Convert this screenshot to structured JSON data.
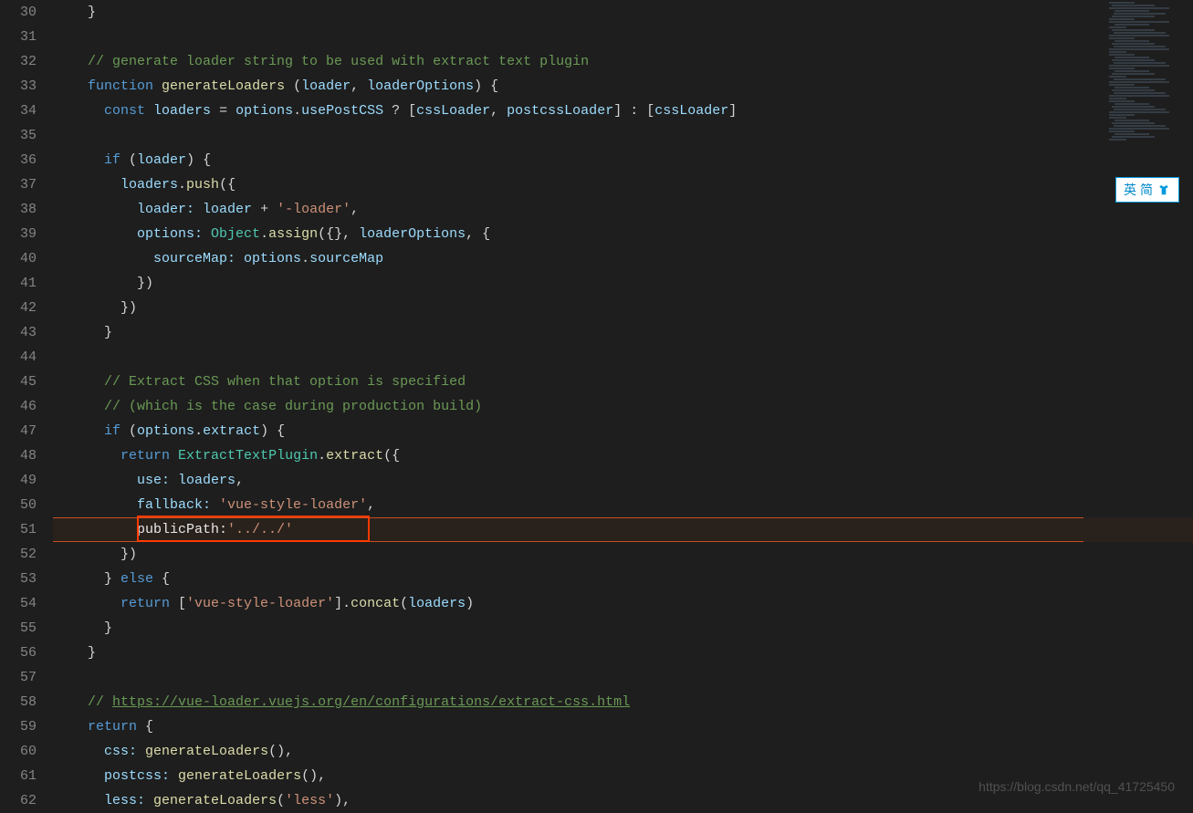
{
  "editor": {
    "startLine": 30,
    "lines": [
      {
        "n": 30,
        "segs": [
          {
            "t": "  }",
            "c": "c-punct"
          }
        ]
      },
      {
        "n": 31,
        "segs": []
      },
      {
        "n": 32,
        "segs": [
          {
            "t": "  ",
            "c": ""
          },
          {
            "t": "// generate loader string to be used with extract text plugin",
            "c": "c-comment"
          }
        ]
      },
      {
        "n": 33,
        "segs": [
          {
            "t": "  ",
            "c": ""
          },
          {
            "t": "function",
            "c": "c-keyword"
          },
          {
            "t": " ",
            "c": ""
          },
          {
            "t": "generateLoaders",
            "c": "c-function"
          },
          {
            "t": " (",
            "c": "c-punct"
          },
          {
            "t": "loader",
            "c": "c-var"
          },
          {
            "t": ", ",
            "c": "c-punct"
          },
          {
            "t": "loaderOptions",
            "c": "c-var"
          },
          {
            "t": ") {",
            "c": "c-punct"
          }
        ]
      },
      {
        "n": 34,
        "segs": [
          {
            "t": "    ",
            "c": ""
          },
          {
            "t": "const",
            "c": "c-keyword"
          },
          {
            "t": " ",
            "c": ""
          },
          {
            "t": "loaders",
            "c": "c-var"
          },
          {
            "t": " = ",
            "c": "c-operator"
          },
          {
            "t": "options",
            "c": "c-var"
          },
          {
            "t": ".",
            "c": "c-punct"
          },
          {
            "t": "usePostCSS",
            "c": "c-var"
          },
          {
            "t": " ? [",
            "c": "c-punct"
          },
          {
            "t": "cssLoader",
            "c": "c-var"
          },
          {
            "t": ", ",
            "c": "c-punct"
          },
          {
            "t": "postcssLoader",
            "c": "c-var"
          },
          {
            "t": "] : [",
            "c": "c-punct"
          },
          {
            "t": "cssLoader",
            "c": "c-var"
          },
          {
            "t": "]",
            "c": "c-punct"
          }
        ]
      },
      {
        "n": 35,
        "segs": []
      },
      {
        "n": 36,
        "segs": [
          {
            "t": "    ",
            "c": ""
          },
          {
            "t": "if",
            "c": "c-keyword"
          },
          {
            "t": " (",
            "c": "c-punct"
          },
          {
            "t": "loader",
            "c": "c-var"
          },
          {
            "t": ") {",
            "c": "c-punct"
          }
        ]
      },
      {
        "n": 37,
        "segs": [
          {
            "t": "      ",
            "c": ""
          },
          {
            "t": "loaders",
            "c": "c-var"
          },
          {
            "t": ".",
            "c": "c-punct"
          },
          {
            "t": "push",
            "c": "c-function"
          },
          {
            "t": "({",
            "c": "c-punct"
          }
        ]
      },
      {
        "n": 38,
        "segs": [
          {
            "t": "        ",
            "c": ""
          },
          {
            "t": "loader:",
            "c": "c-var"
          },
          {
            "t": " ",
            "c": ""
          },
          {
            "t": "loader",
            "c": "c-var"
          },
          {
            "t": " + ",
            "c": "c-operator"
          },
          {
            "t": "'-loader'",
            "c": "c-string"
          },
          {
            "t": ",",
            "c": "c-punct"
          }
        ]
      },
      {
        "n": 39,
        "segs": [
          {
            "t": "        ",
            "c": ""
          },
          {
            "t": "options:",
            "c": "c-var"
          },
          {
            "t": " ",
            "c": ""
          },
          {
            "t": "Object",
            "c": "c-class"
          },
          {
            "t": ".",
            "c": "c-punct"
          },
          {
            "t": "assign",
            "c": "c-function"
          },
          {
            "t": "({}, ",
            "c": "c-punct"
          },
          {
            "t": "loaderOptions",
            "c": "c-var"
          },
          {
            "t": ", {",
            "c": "c-punct"
          }
        ]
      },
      {
        "n": 40,
        "segs": [
          {
            "t": "          ",
            "c": ""
          },
          {
            "t": "sourceMap:",
            "c": "c-var"
          },
          {
            "t": " ",
            "c": ""
          },
          {
            "t": "options",
            "c": "c-var"
          },
          {
            "t": ".",
            "c": "c-punct"
          },
          {
            "t": "sourceMap",
            "c": "c-var"
          }
        ]
      },
      {
        "n": 41,
        "segs": [
          {
            "t": "        })",
            "c": "c-punct"
          }
        ]
      },
      {
        "n": 42,
        "segs": [
          {
            "t": "      })",
            "c": "c-punct"
          }
        ]
      },
      {
        "n": 43,
        "segs": [
          {
            "t": "    }",
            "c": "c-punct"
          }
        ]
      },
      {
        "n": 44,
        "segs": []
      },
      {
        "n": 45,
        "segs": [
          {
            "t": "    ",
            "c": ""
          },
          {
            "t": "// Extract CSS when that option is specified",
            "c": "c-comment"
          }
        ]
      },
      {
        "n": 46,
        "segs": [
          {
            "t": "    ",
            "c": ""
          },
          {
            "t": "// (which is the case during production build)",
            "c": "c-comment"
          }
        ]
      },
      {
        "n": 47,
        "segs": [
          {
            "t": "    ",
            "c": ""
          },
          {
            "t": "if",
            "c": "c-keyword"
          },
          {
            "t": " (",
            "c": "c-punct"
          },
          {
            "t": "options",
            "c": "c-var"
          },
          {
            "t": ".",
            "c": "c-punct"
          },
          {
            "t": "extract",
            "c": "c-var"
          },
          {
            "t": ") {",
            "c": "c-punct"
          }
        ]
      },
      {
        "n": 48,
        "segs": [
          {
            "t": "      ",
            "c": ""
          },
          {
            "t": "return",
            "c": "c-keyword"
          },
          {
            "t": " ",
            "c": ""
          },
          {
            "t": "ExtractTextPlugin",
            "c": "c-class"
          },
          {
            "t": ".",
            "c": "c-punct"
          },
          {
            "t": "extract",
            "c": "c-function"
          },
          {
            "t": "({",
            "c": "c-punct"
          }
        ]
      },
      {
        "n": 49,
        "segs": [
          {
            "t": "        ",
            "c": ""
          },
          {
            "t": "use:",
            "c": "c-var"
          },
          {
            "t": " ",
            "c": ""
          },
          {
            "t": "loaders",
            "c": "c-var"
          },
          {
            "t": ",",
            "c": "c-punct"
          }
        ]
      },
      {
        "n": 50,
        "segs": [
          {
            "t": "        ",
            "c": ""
          },
          {
            "t": "fallback:",
            "c": "c-var"
          },
          {
            "t": " ",
            "c": ""
          },
          {
            "t": "'vue-style-loader'",
            "c": "c-string"
          },
          {
            "t": ",",
            "c": "c-punct"
          }
        ]
      },
      {
        "n": 51,
        "hl": true,
        "segs": [
          {
            "t": "        ",
            "c": ""
          },
          {
            "t": "publicPath:",
            "c": "c-highlight-text"
          },
          {
            "t": "'../../'",
            "c": "c-string"
          }
        ]
      },
      {
        "n": 52,
        "segs": [
          {
            "t": "      })",
            "c": "c-punct"
          }
        ]
      },
      {
        "n": 53,
        "segs": [
          {
            "t": "    } ",
            "c": "c-punct"
          },
          {
            "t": "else",
            "c": "c-keyword"
          },
          {
            "t": " {",
            "c": "c-punct"
          }
        ]
      },
      {
        "n": 54,
        "segs": [
          {
            "t": "      ",
            "c": ""
          },
          {
            "t": "return",
            "c": "c-keyword"
          },
          {
            "t": " [",
            "c": "c-punct"
          },
          {
            "t": "'vue-style-loader'",
            "c": "c-string"
          },
          {
            "t": "].",
            "c": "c-punct"
          },
          {
            "t": "concat",
            "c": "c-function"
          },
          {
            "t": "(",
            "c": "c-punct"
          },
          {
            "t": "loaders",
            "c": "c-var"
          },
          {
            "t": ")",
            "c": "c-punct"
          }
        ]
      },
      {
        "n": 55,
        "segs": [
          {
            "t": "    }",
            "c": "c-punct"
          }
        ]
      },
      {
        "n": 56,
        "segs": [
          {
            "t": "  }",
            "c": "c-punct"
          }
        ]
      },
      {
        "n": 57,
        "segs": []
      },
      {
        "n": 58,
        "segs": [
          {
            "t": "  ",
            "c": ""
          },
          {
            "t": "// ",
            "c": "c-comment"
          },
          {
            "t": "https://vue-loader.vuejs.org/en/configurations/extract-css.html",
            "c": "c-link"
          }
        ]
      },
      {
        "n": 59,
        "segs": [
          {
            "t": "  ",
            "c": ""
          },
          {
            "t": "return",
            "c": "c-keyword"
          },
          {
            "t": " {",
            "c": "c-punct"
          }
        ]
      },
      {
        "n": 60,
        "segs": [
          {
            "t": "    ",
            "c": ""
          },
          {
            "t": "css:",
            "c": "c-var"
          },
          {
            "t": " ",
            "c": ""
          },
          {
            "t": "generateLoaders",
            "c": "c-function"
          },
          {
            "t": "(),",
            "c": "c-punct"
          }
        ]
      },
      {
        "n": 61,
        "segs": [
          {
            "t": "    ",
            "c": ""
          },
          {
            "t": "postcss:",
            "c": "c-var"
          },
          {
            "t": " ",
            "c": ""
          },
          {
            "t": "generateLoaders",
            "c": "c-function"
          },
          {
            "t": "(),",
            "c": "c-punct"
          }
        ]
      },
      {
        "n": 62,
        "segs": [
          {
            "t": "    ",
            "c": ""
          },
          {
            "t": "less:",
            "c": "c-var"
          },
          {
            "t": " ",
            "c": ""
          },
          {
            "t": "generateLoaders",
            "c": "c-function"
          },
          {
            "t": "(",
            "c": "c-punct"
          },
          {
            "t": "'less'",
            "c": "c-string"
          },
          {
            "t": "),",
            "c": "c-punct"
          }
        ]
      }
    ]
  },
  "ime": {
    "text1": "英",
    "text2": "简"
  },
  "watermark": "https://blog.csdn.net/qq_41725450"
}
